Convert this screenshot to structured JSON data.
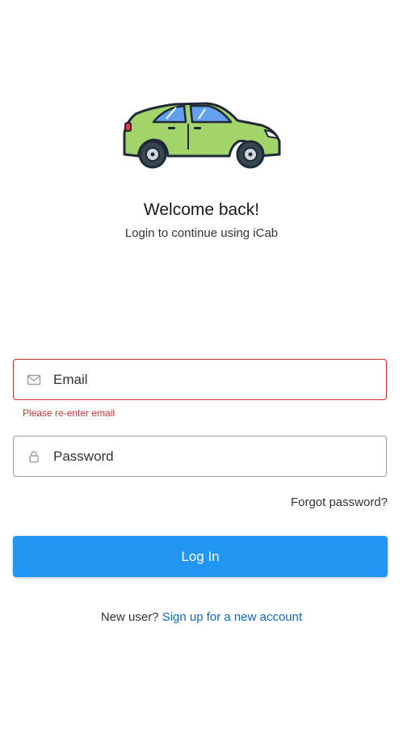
{
  "header": {
    "title": "Welcome back!",
    "subtitle": "Login to continue using iCab"
  },
  "form": {
    "email": {
      "placeholder": "Email",
      "value": "",
      "icon": "mail-icon",
      "error": "Please re-enter email"
    },
    "password": {
      "placeholder": "Password",
      "value": "",
      "icon": "lock-icon"
    },
    "forgot_label": "Forgot password?",
    "login_label": "Log In"
  },
  "signup": {
    "prompt": "New user?",
    "link_label": "Sign up for a new account"
  },
  "colors": {
    "primary": "#2196f3",
    "error": "#d32f2f",
    "link": "#1565c0",
    "car_body": "#a3d46a"
  }
}
